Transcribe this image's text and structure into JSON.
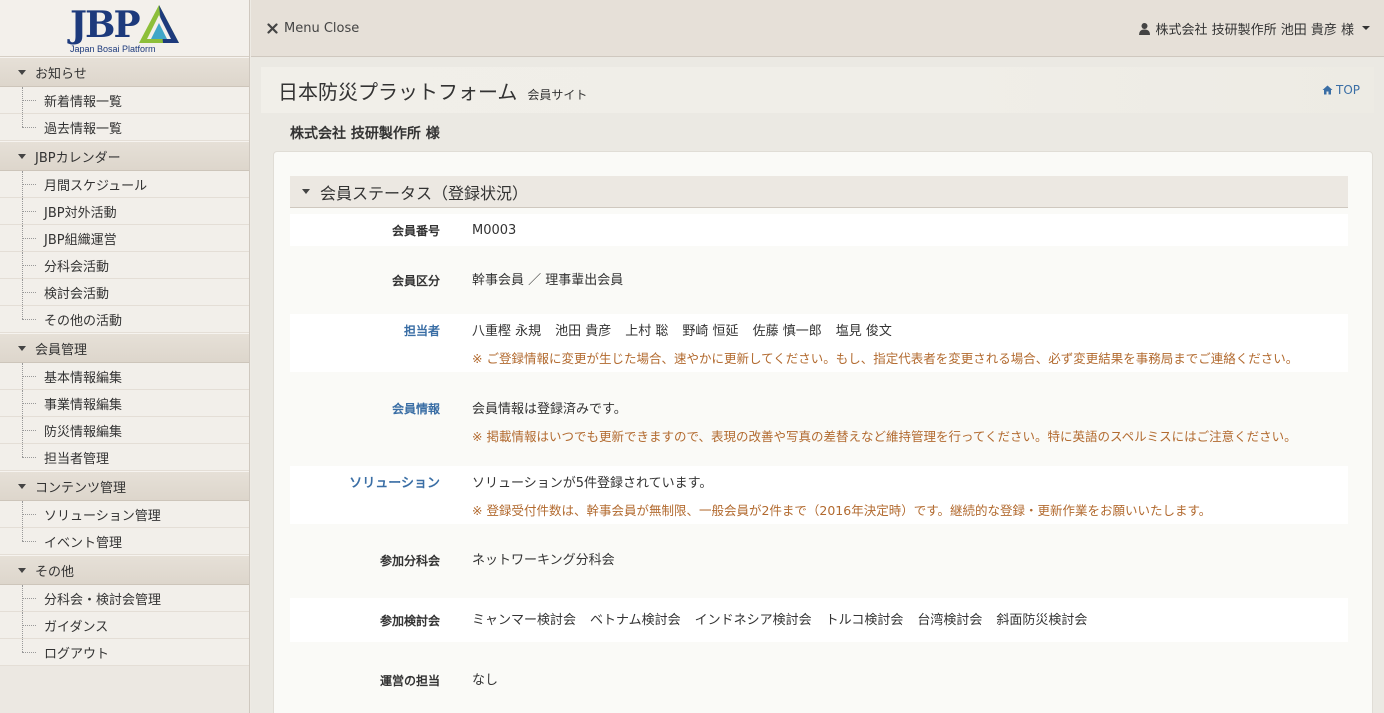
{
  "logo": {
    "text": "JBP",
    "tagline": "Japan Bosai Platform"
  },
  "sidebar": {
    "sections": [
      {
        "label": "お知らせ",
        "items": [
          "新着情報一覧",
          "過去情報一覧"
        ]
      },
      {
        "label": "JBPカレンダー",
        "items": [
          "月間スケジュール",
          "JBP対外活動",
          "JBP組織運営",
          "分科会活動",
          "検討会活動",
          "その他の活動"
        ]
      },
      {
        "label": "会員管理",
        "items": [
          "基本情報編集",
          "事業情報編集",
          "防災情報編集",
          "担当者管理"
        ]
      },
      {
        "label": "コンテンツ管理",
        "items": [
          "ソリューション管理",
          "イベント管理"
        ]
      },
      {
        "label": "その他",
        "items": [
          "分科会・検討会管理",
          "ガイダンス",
          "ログアウト"
        ]
      }
    ]
  },
  "header": {
    "menu_close": "Menu Close",
    "user": "株式会社 技研製作所 池田 貴彦 様"
  },
  "page": {
    "title": "日本防災プラットフォーム",
    "subtitle": "会員サイト",
    "top_link": "TOP",
    "company": "株式会社 技研製作所 様"
  },
  "status": {
    "heading": "会員ステータス（登録状況）",
    "member_no_label": "会員番号",
    "member_no": "M0003",
    "member_class_label": "会員区分",
    "member_class": "幹事会員 ／ 理事輩出会員",
    "contact_label": "担当者",
    "contacts": [
      "八重樫 永規",
      "池田 貴彦",
      "上村 聡",
      "野崎 恒延",
      "佐藤 慎一郎",
      "塩見 俊文"
    ],
    "contact_note": "※ ご登録情報に変更が生じた場合、速やかに更新してください。もし、指定代表者を変更される場合、必ず変更結果を事務局までご連絡ください。",
    "info_label": "会員情報",
    "info": "会員情報は登録済みです。",
    "info_note": "※ 掲載情報はいつでも更新できますので、表現の改善や写真の差替えなど維持管理を行ってください。特に英語のスペルミスにはご注意ください。",
    "solution_label": "ソリューション",
    "solution": "ソリューションが5件登録されています。",
    "solution_note": "※ 登録受付件数は、幹事会員が無制限、一般会員が2件まで（2016年決定時）です。継続的な登録・更新作業をお願いいたします。",
    "subcommittee_label": "参加分科会",
    "subcommittee": "ネットワーキング分科会",
    "study_label": "参加検討会",
    "studies": [
      "ミャンマー検討会",
      "ベトナム検討会",
      "インドネシア検討会",
      "トルコ検討会",
      "台湾検討会",
      "斜面防災検討会"
    ],
    "operation_label": "運営の担当",
    "operation": "なし"
  },
  "colors": {
    "navy": "#1d3a7c",
    "link": "#3a6ea5",
    "note": "#b26a2f"
  }
}
